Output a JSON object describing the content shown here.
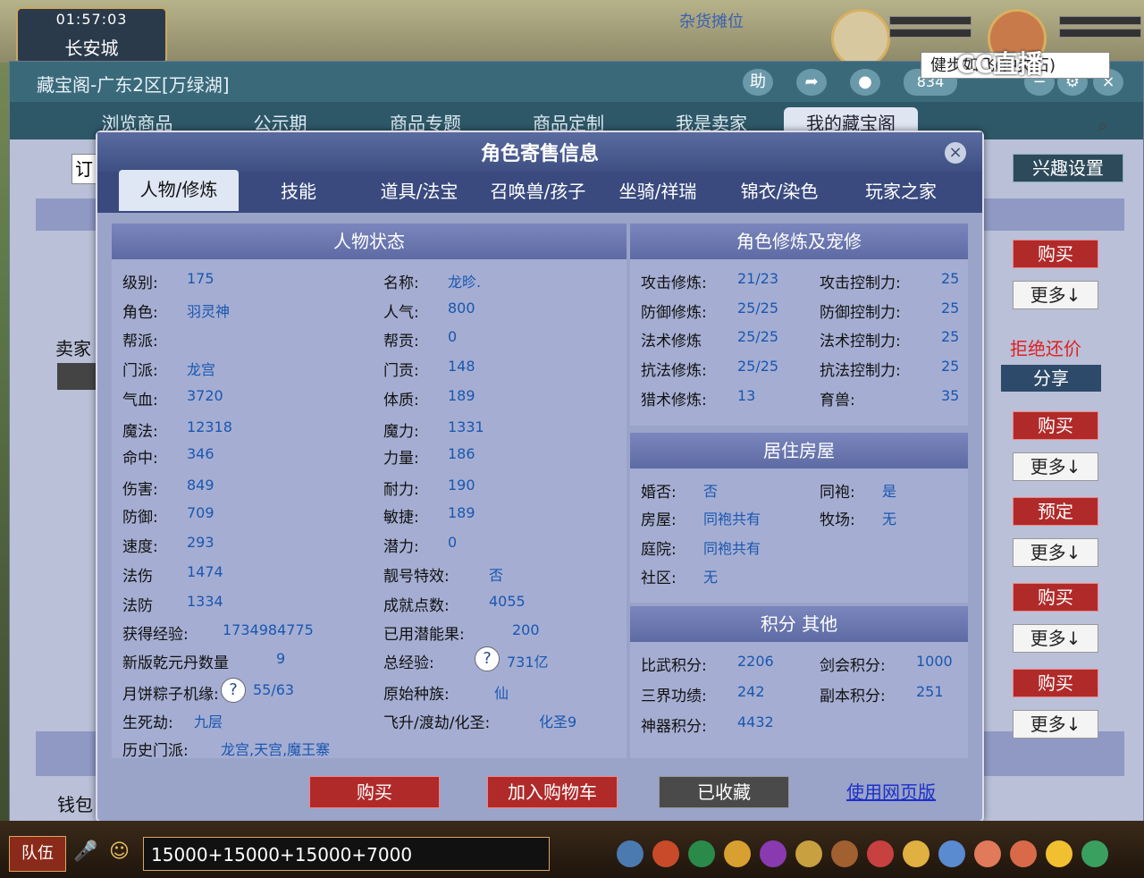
{
  "game": {
    "clock": "01:57:03",
    "city": "长安城",
    "stall_label": "杂货摊位",
    "watermark": "CC直播",
    "chat_text": "15000+15000+15000+7000",
    "team_label": "队伍"
  },
  "window": {
    "title": "藏宝阁-广东2区[万绿湖]",
    "help_icon": "助",
    "badge_count": "834",
    "nav": [
      "浏览商品",
      "公示期",
      "商品专题",
      "商品定制",
      "我是卖家",
      "我的藏宝阁"
    ],
    "search_value": "健步如飞(钟灵石)",
    "hobby_label": "兴趣设置",
    "seller_label": "卖家",
    "wallet_label": "钱包",
    "order_fragment": "订",
    "refuse_bargain": "拒绝还价",
    "share_label": "分享",
    "side_buttons": [
      {
        "primary": "购买",
        "more": "更多↓"
      },
      {
        "primary": "购买",
        "more": "更多↓"
      },
      {
        "primary": "预定",
        "more": "更多↓"
      },
      {
        "primary": "购买",
        "more": "更多↓"
      },
      {
        "primary": "购买",
        "more": "更多↓"
      }
    ]
  },
  "modal": {
    "title": "角色寄售信息",
    "tabs": [
      "人物/修炼",
      "技能",
      "道具/法宝",
      "召唤兽/孩子",
      "坐骑/祥瑞",
      "锦衣/染色",
      "玩家之家"
    ],
    "status_title": "人物状态",
    "status_left": [
      {
        "label": "级别:",
        "value": "175"
      },
      {
        "label": "角色:",
        "value": "羽灵神"
      },
      {
        "label": "帮派:",
        "value": ""
      },
      {
        "label": "门派:",
        "value": "龙宫"
      },
      {
        "label": "气血:",
        "value": "3720"
      },
      {
        "label": "魔法:",
        "value": "12318"
      },
      {
        "label": "命中:",
        "value": "346"
      },
      {
        "label": "伤害:",
        "value": "849"
      },
      {
        "label": "防御:",
        "value": "709"
      },
      {
        "label": "速度:",
        "value": "293"
      },
      {
        "label": "法伤",
        "value": "1474"
      },
      {
        "label": "法防",
        "value": "1334"
      },
      {
        "label": "获得经验:",
        "value": "1734984775"
      },
      {
        "label": "新版乾元丹数量",
        "value": "9"
      },
      {
        "label": "月饼粽子机缘:",
        "value": "55/63"
      },
      {
        "label": "生死劫:",
        "value": "九层"
      },
      {
        "label": "历史门派:",
        "value": "龙宫,天宫,魔王寨"
      }
    ],
    "status_right": [
      {
        "label": "名称:",
        "value": "龙昣."
      },
      {
        "label": "人气:",
        "value": "800"
      },
      {
        "label": "帮贡:",
        "value": "0"
      },
      {
        "label": "门贡:",
        "value": "148"
      },
      {
        "label": "体质:",
        "value": "189"
      },
      {
        "label": "魔力:",
        "value": "1331"
      },
      {
        "label": "力量:",
        "value": "186"
      },
      {
        "label": "耐力:",
        "value": "190"
      },
      {
        "label": "敏捷:",
        "value": "189"
      },
      {
        "label": "潜力:",
        "value": "0"
      },
      {
        "label": "靓号特效:",
        "value": "否"
      },
      {
        "label": "成就点数:",
        "value": "4055"
      },
      {
        "label": "已用潜能果:",
        "value": "200"
      },
      {
        "label": "总经验:",
        "value": "731亿"
      },
      {
        "label": "原始种族:",
        "value": "仙"
      },
      {
        "label": "飞升/渡劫/化圣:",
        "value": "化圣9"
      }
    ],
    "cultivation_title": "角色修炼及宠修",
    "cultivation": [
      {
        "l1": "攻击修炼:",
        "v1": "21/23",
        "l2": "攻击控制力:",
        "v2": "25"
      },
      {
        "l1": "防御修炼:",
        "v1": "25/25",
        "l2": "防御控制力:",
        "v2": "25"
      },
      {
        "l1": "法术修炼",
        "v1": "25/25",
        "l2": "法术控制力:",
        "v2": "25"
      },
      {
        "l1": "抗法修炼:",
        "v1": "25/25",
        "l2": "抗法控制力:",
        "v2": "25"
      },
      {
        "l1": "猎术修炼:",
        "v1": "13",
        "l2": "育兽:",
        "v2": "35"
      }
    ],
    "house_title": "居住房屋",
    "house": [
      {
        "l1": "婚否:",
        "v1": "否",
        "l2": "同袍:",
        "v2": "是"
      },
      {
        "l1": "房屋:",
        "v1": "同袍共有",
        "l2": "牧场:",
        "v2": "无"
      },
      {
        "l1": "庭院:",
        "v1": "同袍共有",
        "l2": "",
        "v2": ""
      },
      {
        "l1": "社区:",
        "v1": "无",
        "l2": "",
        "v2": ""
      }
    ],
    "score_title": "积分 其他",
    "score": [
      {
        "l1": "比武积分:",
        "v1": "2206",
        "l2": "剑会积分:",
        "v2": "1000"
      },
      {
        "l1": "三界功绩:",
        "v1": "242",
        "l2": "副本积分:",
        "v2": "251"
      },
      {
        "l1": "神器积分:",
        "v1": "4432",
        "l2": "",
        "v2": ""
      }
    ],
    "buttons": {
      "buy": "购买",
      "cart": "加入购物车",
      "favorited": "已收藏",
      "web": "使用网页版"
    }
  }
}
